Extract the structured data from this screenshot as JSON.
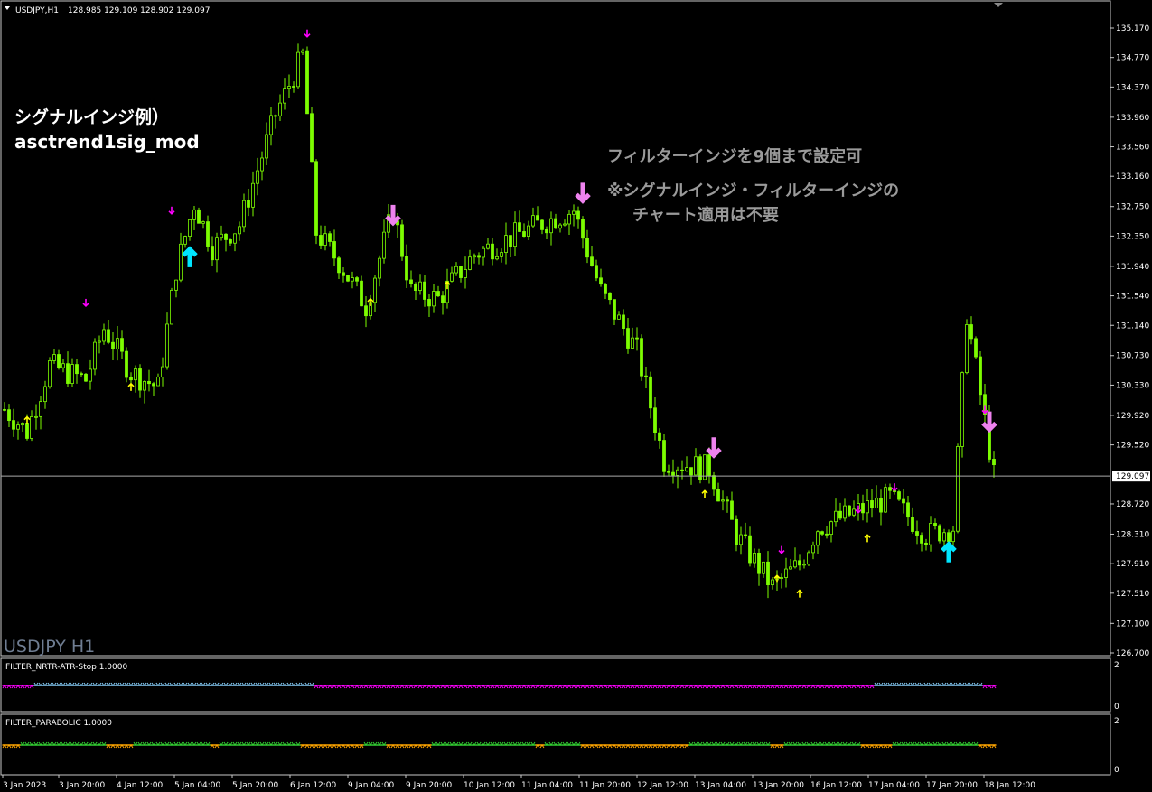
{
  "header": {
    "symbol_tf": "USDJPY,H1",
    "ohlc": "128.985 129.109 128.902 129.097"
  },
  "watermark": "USDJPY H1",
  "annotations": {
    "signal_line1": "シグナルインジ例）",
    "signal_line2": "asctrend1sig_mod",
    "filter_line1": "フィルターインジを9個まで設定可",
    "filter_line2": "※シグナルインジ・フィルターインジの",
    "filter_line3": "チャート適用は不要"
  },
  "subwindows": [
    {
      "label": "FILTER_NRTR-ATR-Stop 1.0000",
      "ymax": "2",
      "ymin": "0"
    },
    {
      "label": "FILTER_PARABOLIC 1.0000",
      "ymax": "2",
      "ymin": "0"
    }
  ],
  "colors": {
    "background": "#000000",
    "candle": "#7CFC00",
    "grid_frame": "#C8C8C8",
    "signal_up_small": "#FFFF00",
    "signal_down_small": "#FF00FF",
    "signal_up_big": "#00E5FF",
    "signal_down_big": "#EE82EE",
    "nrtr_bear": "#FF00FF",
    "nrtr_bull": "#87CEFA",
    "psar_bull": "#32CD32",
    "psar_bear": "#FFA500"
  },
  "chart_data": {
    "type": "candlestick",
    "symbol": "USDJPY",
    "timeframe": "H1",
    "ylim": [
      126.7,
      135.37
    ],
    "y_ticks": [
      "135.170",
      "134.770",
      "134.370",
      "133.960",
      "133.560",
      "133.160",
      "132.750",
      "132.350",
      "131.940",
      "131.540",
      "131.140",
      "130.730",
      "130.330",
      "129.920",
      "129.520",
      "129.097",
      "128.720",
      "128.310",
      "127.910",
      "127.510",
      "127.100",
      "126.700"
    ],
    "current_price": 129.097,
    "current_price_label": "129.097",
    "x_ticks": [
      "3 Jan 2023",
      "3 Jan 20:00",
      "4 Jan 12:00",
      "5 Jan 04:00",
      "5 Jan 20:00",
      "6 Jan 12:00",
      "9 Jan 04:00",
      "9 Jan 20:00",
      "10 Jan 12:00",
      "11 Jan 04:00",
      "11 Jan 20:00",
      "12 Jan 12:00",
      "13 Jan 04:00",
      "13 Jan 20:00",
      "16 Jan 12:00",
      "17 Jan 04:00",
      "17 Jan 20:00",
      "18 Jan 12:00"
    ],
    "bars": 220,
    "price_path": [
      [
        0,
        130.0
      ],
      [
        5,
        129.7
      ],
      [
        10,
        130.6
      ],
      [
        18,
        130.4
      ],
      [
        22,
        131.1
      ],
      [
        28,
        130.5
      ],
      [
        34,
        130.3
      ],
      [
        38,
        131.9
      ],
      [
        42,
        132.8
      ],
      [
        46,
        132.2
      ],
      [
        52,
        132.5
      ],
      [
        60,
        134.0
      ],
      [
        66,
        134.8
      ],
      [
        69,
        132.4
      ],
      [
        74,
        132.0
      ],
      [
        80,
        131.4
      ],
      [
        86,
        132.7
      ],
      [
        90,
        131.6
      ],
      [
        96,
        131.5
      ],
      [
        104,
        132.1
      ],
      [
        118,
        132.5
      ],
      [
        126,
        132.7
      ],
      [
        132,
        131.6
      ],
      [
        140,
        130.8
      ],
      [
        146,
        129.3
      ],
      [
        156,
        129.2
      ],
      [
        162,
        128.3
      ],
      [
        170,
        127.6
      ],
      [
        176,
        127.9
      ],
      [
        180,
        128.4
      ],
      [
        188,
        128.6
      ],
      [
        196,
        128.8
      ],
      [
        204,
        128.3
      ],
      [
        210,
        128.4
      ],
      [
        213,
        131.3
      ],
      [
        216,
        130.2
      ],
      [
        219,
        129.1
      ]
    ],
    "signals": [
      {
        "bar": 5,
        "dir": "up",
        "size": "small",
        "price": 129.85
      },
      {
        "bar": 18,
        "dir": "down",
        "size": "small",
        "price": 131.45
      },
      {
        "bar": 28,
        "dir": "up",
        "size": "small",
        "price": 130.3
      },
      {
        "bar": 37,
        "dir": "down",
        "size": "small",
        "price": 132.7
      },
      {
        "bar": 41,
        "dir": "up",
        "size": "big",
        "price": 132.05
      },
      {
        "bar": 67,
        "dir": "down",
        "size": "small",
        "price": 135.1
      },
      {
        "bar": 81,
        "dir": "up",
        "size": "small",
        "price": 131.45
      },
      {
        "bar": 86,
        "dir": "down",
        "size": "big",
        "price": 132.65
      },
      {
        "bar": 98,
        "dir": "up",
        "size": "small",
        "price": 131.68
      },
      {
        "bar": 128,
        "dir": "down",
        "size": "big",
        "price": 132.95
      },
      {
        "bar": 155,
        "dir": "up",
        "size": "small",
        "price": 128.85
      },
      {
        "bar": 157,
        "dir": "down",
        "size": "big",
        "price": 129.5
      },
      {
        "bar": 171,
        "dir": "up",
        "size": "small",
        "price": 127.7
      },
      {
        "bar": 172,
        "dir": "down",
        "size": "small",
        "price": 128.1
      },
      {
        "bar": 176,
        "dir": "up",
        "size": "small",
        "price": 127.5
      },
      {
        "bar": 189,
        "dir": "down",
        "size": "small",
        "price": 128.65
      },
      {
        "bar": 191,
        "dir": "up",
        "size": "small",
        "price": 128.25
      },
      {
        "bar": 197,
        "dir": "down",
        "size": "small",
        "price": 128.95
      },
      {
        "bar": 209,
        "dir": "up",
        "size": "big",
        "price": 128.05
      },
      {
        "bar": 217,
        "dir": "down",
        "size": "small",
        "price": 130.0
      },
      {
        "bar": 218,
        "dir": "down",
        "size": "big",
        "price": 129.85
      }
    ],
    "nrtr_segments": [
      {
        "from": 0,
        "to": 7,
        "state": "bear"
      },
      {
        "from": 7,
        "to": 69,
        "state": "bull"
      },
      {
        "from": 69,
        "to": 193,
        "state": "bear"
      },
      {
        "from": 193,
        "to": 217,
        "state": "bull"
      },
      {
        "from": 217,
        "to": 220,
        "state": "bear"
      }
    ],
    "psar_segments": [
      {
        "from": 0,
        "to": 4,
        "state": "bear"
      },
      {
        "from": 4,
        "to": 23,
        "state": "bull"
      },
      {
        "from": 23,
        "to": 29,
        "state": "bear"
      },
      {
        "from": 29,
        "to": 46,
        "state": "bull"
      },
      {
        "from": 46,
        "to": 48,
        "state": "bear"
      },
      {
        "from": 48,
        "to": 66,
        "state": "bull"
      },
      {
        "from": 66,
        "to": 80,
        "state": "bear"
      },
      {
        "from": 80,
        "to": 85,
        "state": "bull"
      },
      {
        "from": 85,
        "to": 95,
        "state": "bear"
      },
      {
        "from": 95,
        "to": 100,
        "state": "bull"
      },
      {
        "from": 100,
        "to": 118,
        "state": "bull"
      },
      {
        "from": 118,
        "to": 120,
        "state": "bear"
      },
      {
        "from": 120,
        "to": 128,
        "state": "bull"
      },
      {
        "from": 128,
        "to": 152,
        "state": "bear"
      },
      {
        "from": 152,
        "to": 170,
        "state": "bull"
      },
      {
        "from": 170,
        "to": 173,
        "state": "bear"
      },
      {
        "from": 173,
        "to": 190,
        "state": "bull"
      },
      {
        "from": 190,
        "to": 197,
        "state": "bear"
      },
      {
        "from": 197,
        "to": 210,
        "state": "bull"
      },
      {
        "from": 210,
        "to": 216,
        "state": "bull"
      },
      {
        "from": 216,
        "to": 220,
        "state": "bear"
      }
    ]
  }
}
